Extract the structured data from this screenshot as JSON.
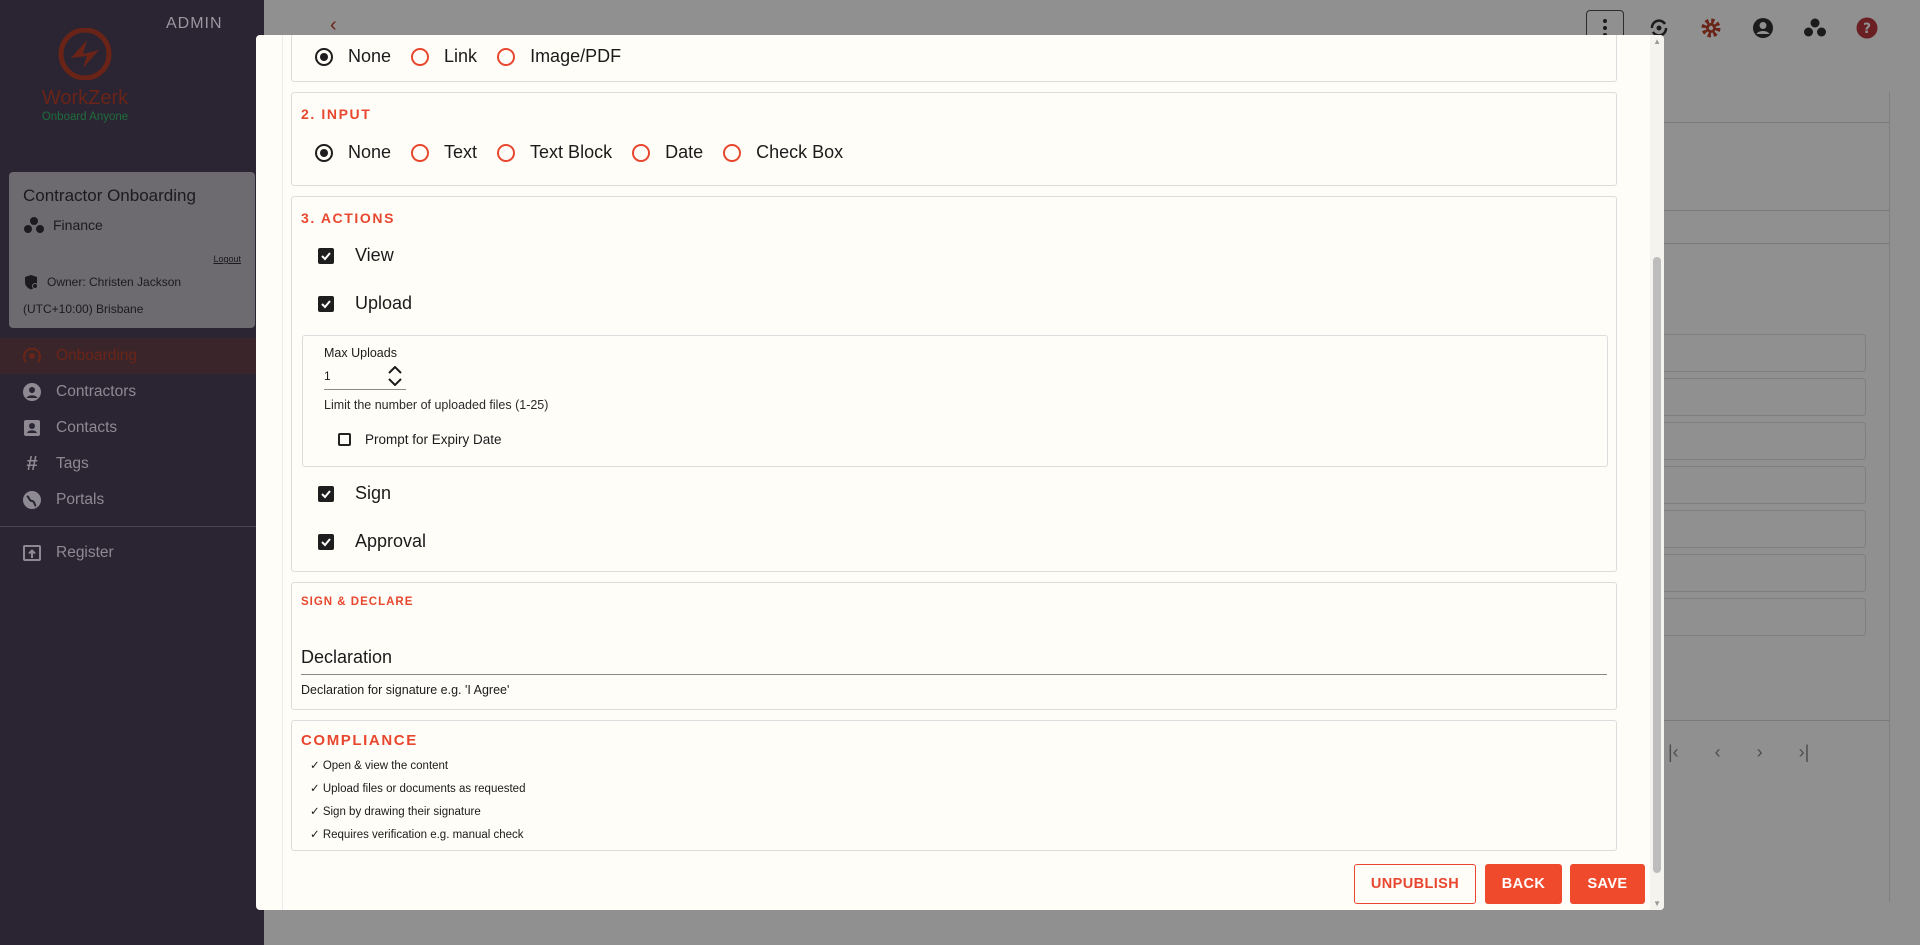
{
  "app": {
    "admin_label": "ADMIN",
    "brand": "WorkZerk",
    "tagline": "Onboard Anyone"
  },
  "card": {
    "title": "Contractor Onboarding",
    "department": "Finance",
    "logout": "Logout",
    "owner": "Owner: Christen Jackson",
    "timezone": "(UTC+10:00) Brisbane"
  },
  "nav": {
    "items": [
      {
        "label": "Onboarding",
        "icon": "onboarding-icon",
        "active": true
      },
      {
        "label": "Contractors",
        "icon": "person-icon"
      },
      {
        "label": "Contacts",
        "icon": "contacts-icon"
      },
      {
        "label": "Tags",
        "icon": "hash-icon"
      },
      {
        "label": "Portals",
        "icon": "globe-icon"
      }
    ],
    "register": "Register"
  },
  "topbar": {
    "icons": [
      "more-vert-icon",
      "sync-icon",
      "settings-icon",
      "account-icon",
      "group-icon",
      "help-icon"
    ]
  },
  "modal": {
    "content_type": {
      "options": [
        "None",
        "Link",
        "Image/PDF"
      ],
      "selected": "None"
    },
    "input": {
      "title": "2. INPUT",
      "options": [
        "None",
        "Text",
        "Text Block",
        "Date",
        "Check Box"
      ],
      "selected": "None"
    },
    "actions": {
      "title": "3. ACTIONS",
      "view": "View",
      "upload": "Upload",
      "max_uploads_label": "Max Uploads",
      "max_uploads_value": "1",
      "max_uploads_helper": "Limit the number of uploaded files (1-25)",
      "expiry_label": "Prompt for Expiry Date",
      "expiry_checked": false,
      "sign": "Sign",
      "approval": "Approval",
      "checked": {
        "view": true,
        "upload": true,
        "sign": true,
        "approval": true
      }
    },
    "sign_declare": {
      "title": "SIGN & DECLARE",
      "field_value": "Declaration",
      "helper": "Declaration for signature e.g. 'I Agree'"
    },
    "compliance": {
      "title": "COMPLIANCE",
      "items": [
        "✓ Open & view the content",
        "✓ Upload files or documents as requested",
        "✓ Sign by drawing their signature",
        "✓ Requires verification e.g. manual check"
      ]
    },
    "buttons": {
      "unpublish": "UNPUBLISH",
      "back": "BACK",
      "save": "SAVE"
    }
  },
  "colors": {
    "accent": "#e8472f",
    "sidebar_bg": "#2a2433",
    "modal_bg": "#fffdf8"
  }
}
